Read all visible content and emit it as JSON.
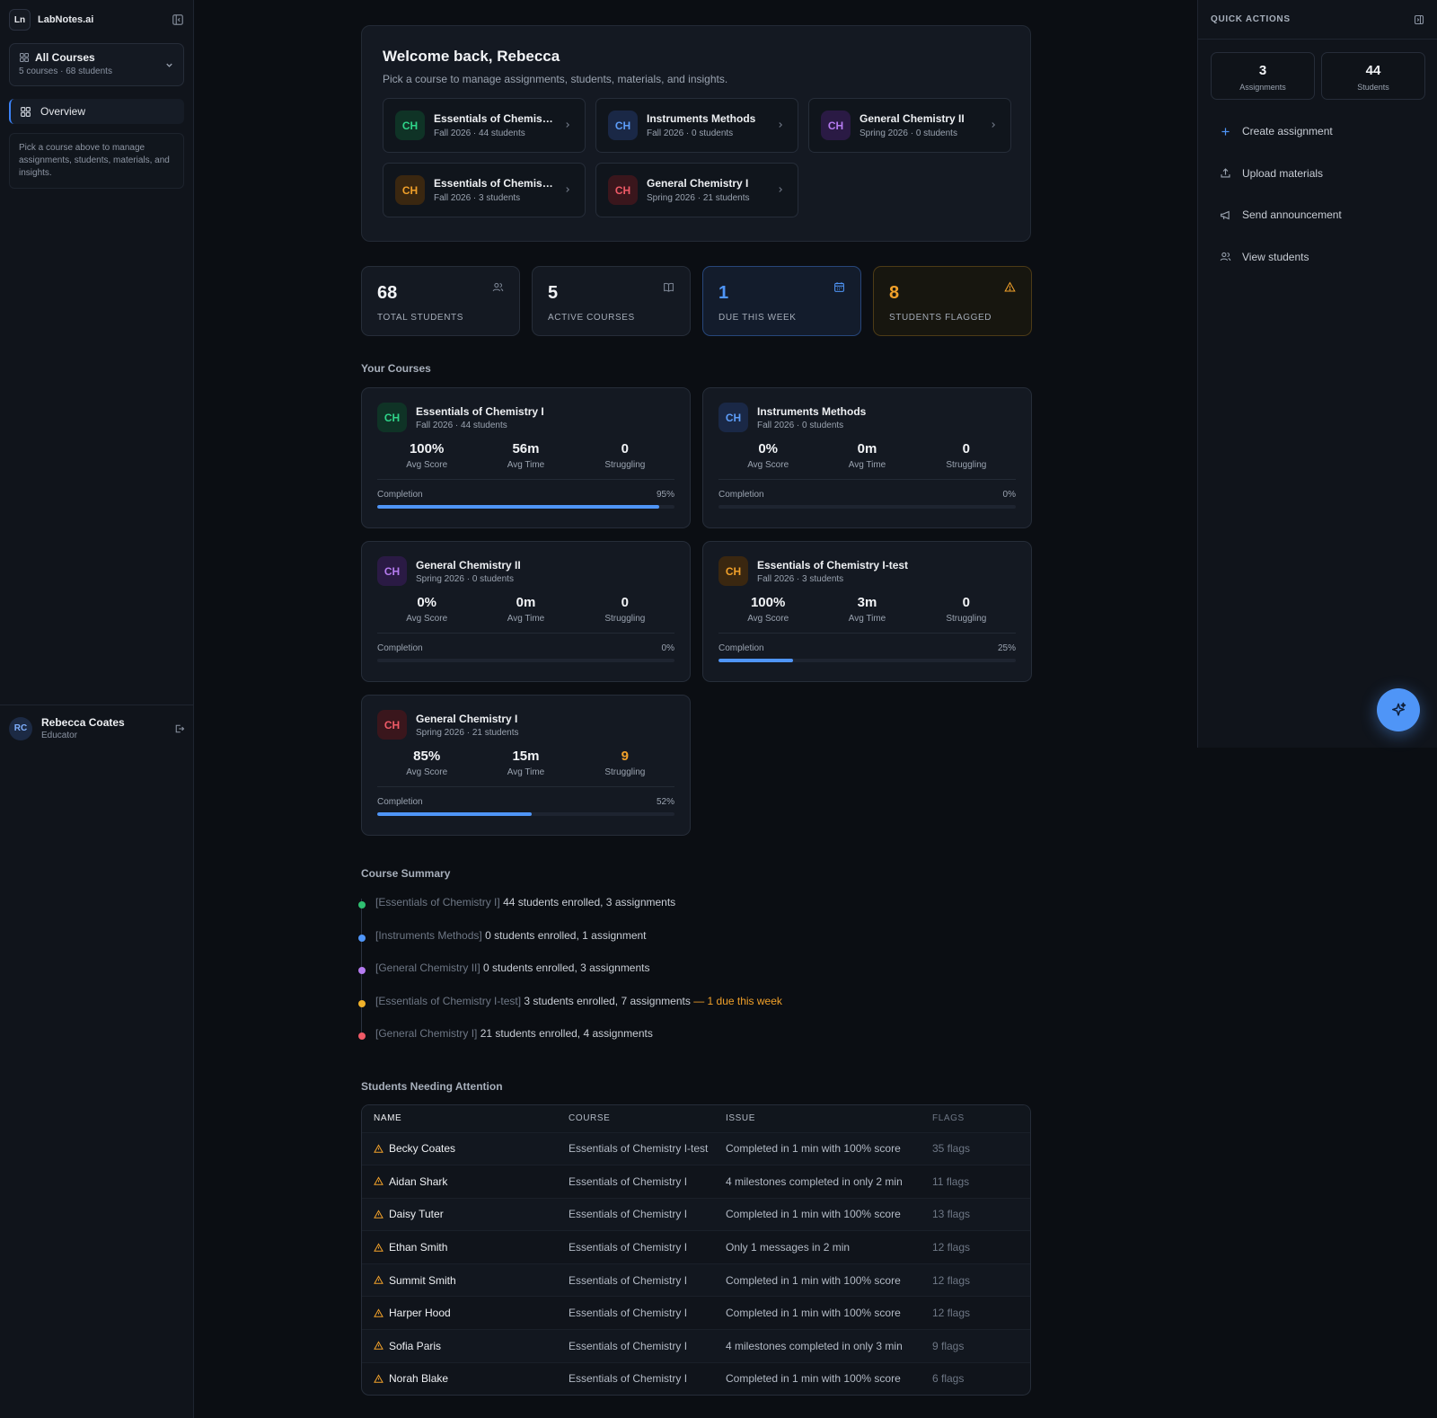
{
  "brand": {
    "logo_text": "Ln",
    "name": "LabNotes.ai"
  },
  "course_selector": {
    "title": "All Courses",
    "subtitle": "5 courses · 68 students"
  },
  "nav": {
    "overview": "Overview"
  },
  "sidebar_hint": "Pick a course above to manage assignments, students, materials, and insights.",
  "user": {
    "initials": "RC",
    "name": "Rebecca Coates",
    "role": "Educator"
  },
  "welcome": {
    "title": "Welcome back, Rebecca",
    "subtitle": "Pick a course to manage assignments, students, materials, and insights.",
    "courses": [
      {
        "badge": "CH",
        "name": "Essentials of Chemist...",
        "meta": "Fall 2026 · 44 students",
        "color": "green"
      },
      {
        "badge": "CH",
        "name": "Instruments Methods",
        "meta": "Fall 2026 · 0 students",
        "color": "blue"
      },
      {
        "badge": "CH",
        "name": "General Chemistry II",
        "meta": "Spring 2026 · 0 students",
        "color": "purple"
      },
      {
        "badge": "CH",
        "name": "Essentials of Chemist...",
        "meta": "Fall 2026 · 3 students",
        "color": "orange"
      },
      {
        "badge": "CH",
        "name": "General Chemistry I",
        "meta": "Spring 2026 · 21 students",
        "color": "red"
      }
    ]
  },
  "stats": {
    "total_students": {
      "value": "68",
      "label": "TOTAL STUDENTS"
    },
    "active_courses": {
      "value": "5",
      "label": "ACTIVE COURSES"
    },
    "due_this_week": {
      "value": "1",
      "label": "DUE THIS WEEK"
    },
    "students_flagged": {
      "value": "8",
      "label": "STUDENTS FLAGGED"
    }
  },
  "your_courses": {
    "title": "Your Courses",
    "labels": {
      "avg_score": "Avg Score",
      "avg_time": "Avg Time",
      "struggling": "Struggling",
      "completion": "Completion"
    },
    "cards": [
      {
        "badge": "CH",
        "name": "Essentials of Chemistry I",
        "meta": "Fall 2026 · 44 students",
        "avg_score": "100%",
        "avg_time": "56m",
        "struggling": "0",
        "completion_label": "95%",
        "completion": 0.95,
        "color": "green"
      },
      {
        "badge": "CH",
        "name": "Instruments Methods",
        "meta": "Fall 2026 · 0 students",
        "avg_score": "0%",
        "avg_time": "0m",
        "struggling": "0",
        "completion_label": "0%",
        "completion": 0,
        "color": "blue"
      },
      {
        "badge": "CH",
        "name": "General Chemistry II",
        "meta": "Spring 2026 · 0 students",
        "avg_score": "0%",
        "avg_time": "0m",
        "struggling": "0",
        "completion_label": "0%",
        "completion": 0,
        "color": "purple"
      },
      {
        "badge": "CH",
        "name": "Essentials of Chemistry I-test",
        "meta": "Fall 2026 · 3 students",
        "avg_score": "100%",
        "avg_time": "3m",
        "struggling": "0",
        "completion_label": "25%",
        "completion": 0.25,
        "color": "orange"
      },
      {
        "badge": "CH",
        "name": "General Chemistry I",
        "meta": "Spring 2026 · 21 students",
        "avg_score": "85%",
        "avg_time": "15m",
        "struggling": "9",
        "completion_label": "52%",
        "completion": 0.52,
        "color": "red",
        "struggling_warn": true
      }
    ]
  },
  "summary": {
    "title": "Course Summary",
    "items": [
      {
        "course": "[Essentials of Chemistry I]",
        "text": "44 students enrolled, 3 assignments",
        "due": "",
        "color": "#2fbf71"
      },
      {
        "course": "[Instruments Methods]",
        "text": "0 students enrolled, 1 assignment",
        "due": "",
        "color": "#4f95f7"
      },
      {
        "course": "[General Chemistry II]",
        "text": "0 students enrolled, 3 assignments",
        "due": "",
        "color": "#b57bf0"
      },
      {
        "course": "[Essentials of Chemistry I-test]",
        "text": "3 students enrolled, 7 assignments",
        "due": "— 1 due this week",
        "color": "#f0b12a"
      },
      {
        "course": "[General Chemistry I]",
        "text": "21 students enrolled, 4 assignments",
        "due": "",
        "color": "#ef5a67"
      }
    ]
  },
  "attention": {
    "title": "Students Needing Attention",
    "headers": {
      "name": "NAME",
      "course": "COURSE",
      "issue": "ISSUE",
      "flags": "FLAGS"
    },
    "rows": [
      {
        "name": "Becky Coates",
        "course": "Essentials of Chemistry I-test",
        "issue": "Completed in 1 min with 100% score",
        "flags": "35 flags"
      },
      {
        "name": "Aidan Shark",
        "course": "Essentials of Chemistry I",
        "issue": "4 milestones completed in only 2 min",
        "flags": "11 flags"
      },
      {
        "name": "Daisy Tuter",
        "course": "Essentials of Chemistry I",
        "issue": "Completed in 1 min with 100% score",
        "flags": "13 flags"
      },
      {
        "name": "Ethan Smith",
        "course": "Essentials of Chemistry I",
        "issue": "Only 1 messages in 2 min",
        "flags": "12 flags"
      },
      {
        "name": "Summit Smith",
        "course": "Essentials of Chemistry I",
        "issue": "Completed in 1 min with 100% score",
        "flags": "12 flags"
      },
      {
        "name": "Harper Hood",
        "course": "Essentials of Chemistry I",
        "issue": "Completed in 1 min with 100% score",
        "flags": "12 flags"
      },
      {
        "name": "Sofia Paris",
        "course": "Essentials of Chemistry I",
        "issue": "4 milestones completed in only 3 min",
        "flags": "9 flags"
      },
      {
        "name": "Norah Blake",
        "course": "Essentials of Chemistry I",
        "issue": "Completed in 1 min with 100% score",
        "flags": "6 flags"
      }
    ]
  },
  "quick_actions": {
    "title": "QUICK ACTIONS",
    "assignments": {
      "value": "3",
      "label": "Assignments"
    },
    "students": {
      "value": "44",
      "label": "Students"
    },
    "items": [
      {
        "label": "Create assignment",
        "icon": "plus-icon"
      },
      {
        "label": "Upload materials",
        "icon": "upload-icon"
      },
      {
        "label": "Send announcement",
        "icon": "megaphone-icon"
      },
      {
        "label": "View students",
        "icon": "users-icon"
      }
    ]
  },
  "badge_colors": {
    "green": {
      "bg": "#0f3326",
      "fg": "#2fd489"
    },
    "blue": {
      "bg": "#1a2846",
      "fg": "#5d9df8"
    },
    "purple": {
      "bg": "#2a1a44",
      "fg": "#b57bf0"
    },
    "orange": {
      "bg": "#3a2710",
      "fg": "#f0a02a"
    },
    "red": {
      "bg": "#3a161c",
      "fg": "#ef5a67"
    }
  }
}
